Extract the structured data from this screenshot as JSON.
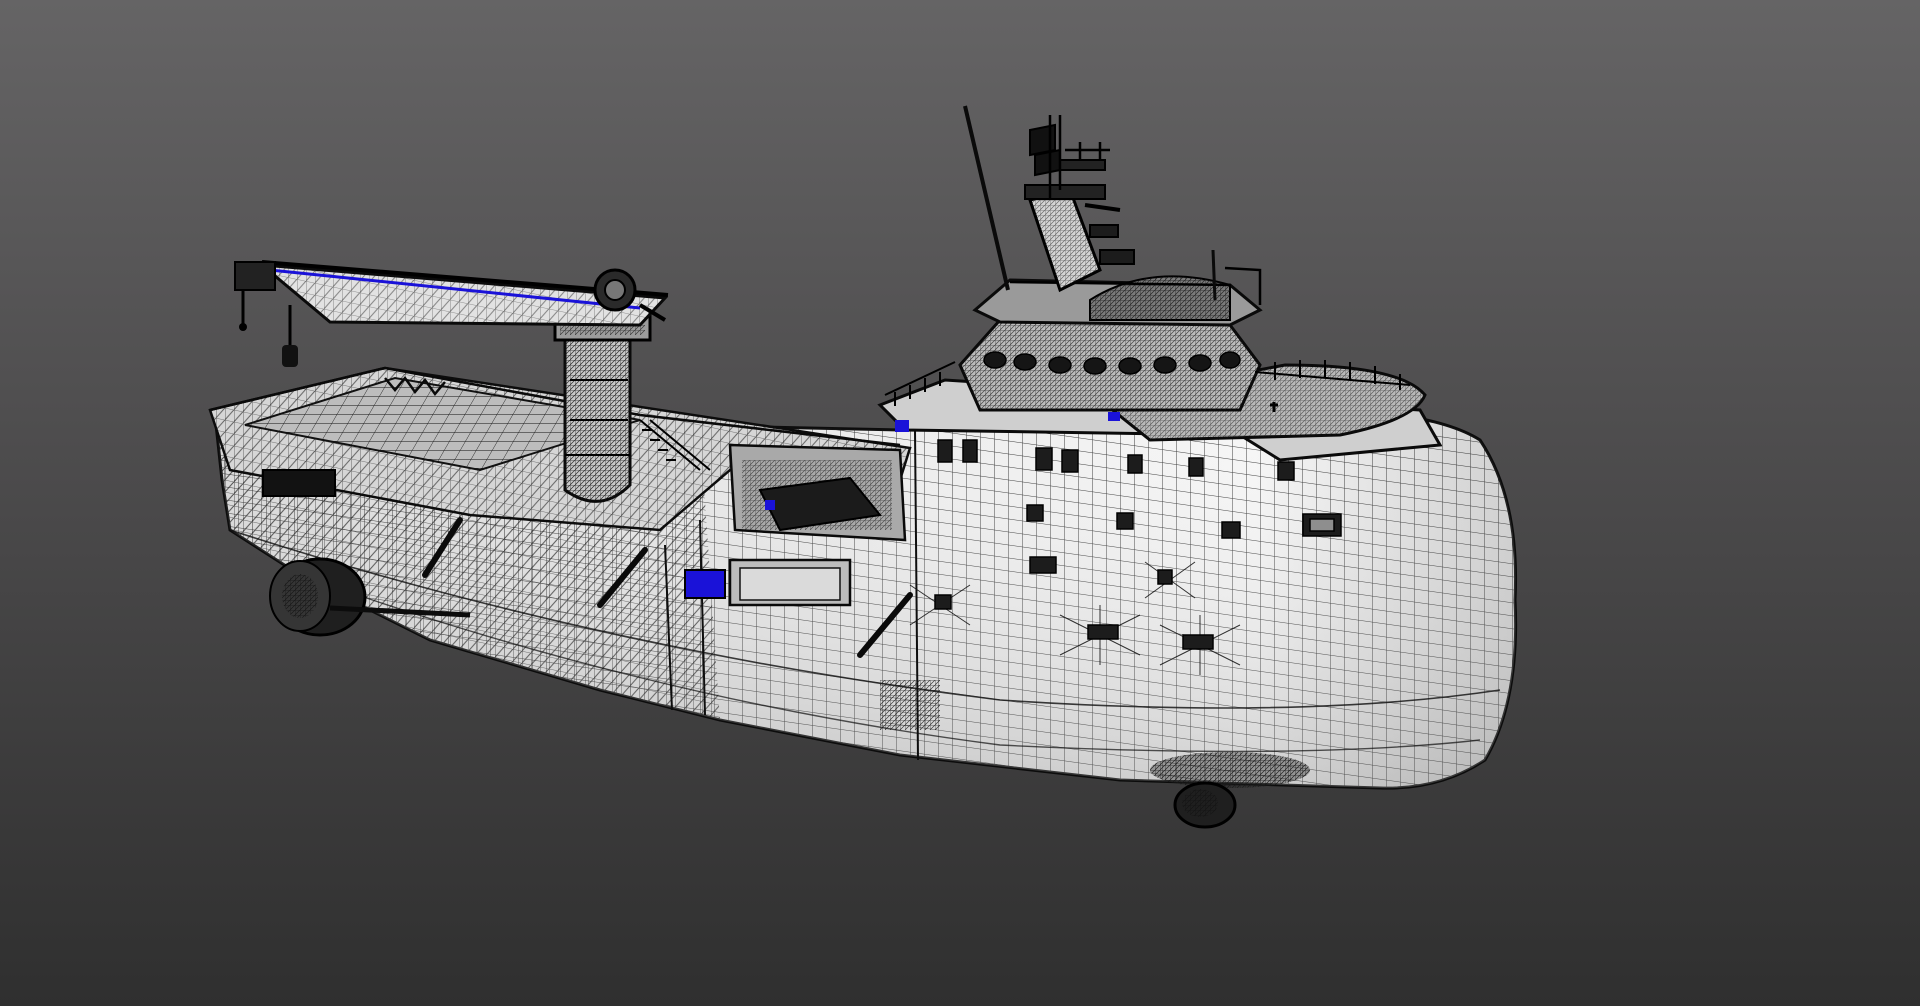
{
  "viewport": {
    "background_top": "#656465",
    "background_bottom": "#2f2f2f"
  },
  "model": {
    "render_mode": "wireframe-on-shaded",
    "shading_color": "#e9e9e9",
    "wire_color": "#111111",
    "highlight_color": "#1a12d8",
    "icon": "ship-model-icon"
  }
}
